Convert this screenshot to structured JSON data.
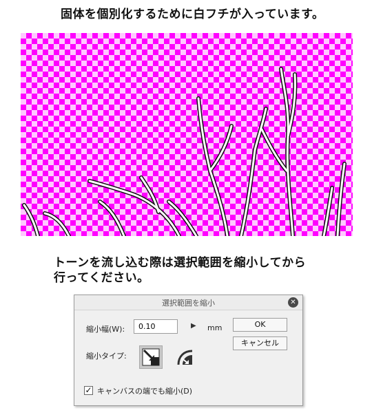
{
  "captions": {
    "top": "固体を個別化するために白フチが入っています。",
    "mid_line1": "トーンを流し込む際は選択範囲を縮小してから",
    "mid_line2": "行ってください。"
  },
  "colors": {
    "checker_a": "#ff00ff",
    "checker_b": "#ffc8ff",
    "branch": "#ffffff",
    "branch_outline": "#111111"
  },
  "dialog": {
    "title": "選択範囲を縮小",
    "close_icon": "close-icon",
    "shrink_label": "縮小幅(W):",
    "shrink_value": "0.10",
    "unit": "mm",
    "ok_label": "OK",
    "cancel_label": "キャンセル",
    "type_label": "縮小タイプ:",
    "type_options": [
      "shrink-corner-icon",
      "shrink-curve-icon"
    ],
    "checkbox_checked": true,
    "checkbox_label": "キャンバスの端でも縮小(D)"
  }
}
